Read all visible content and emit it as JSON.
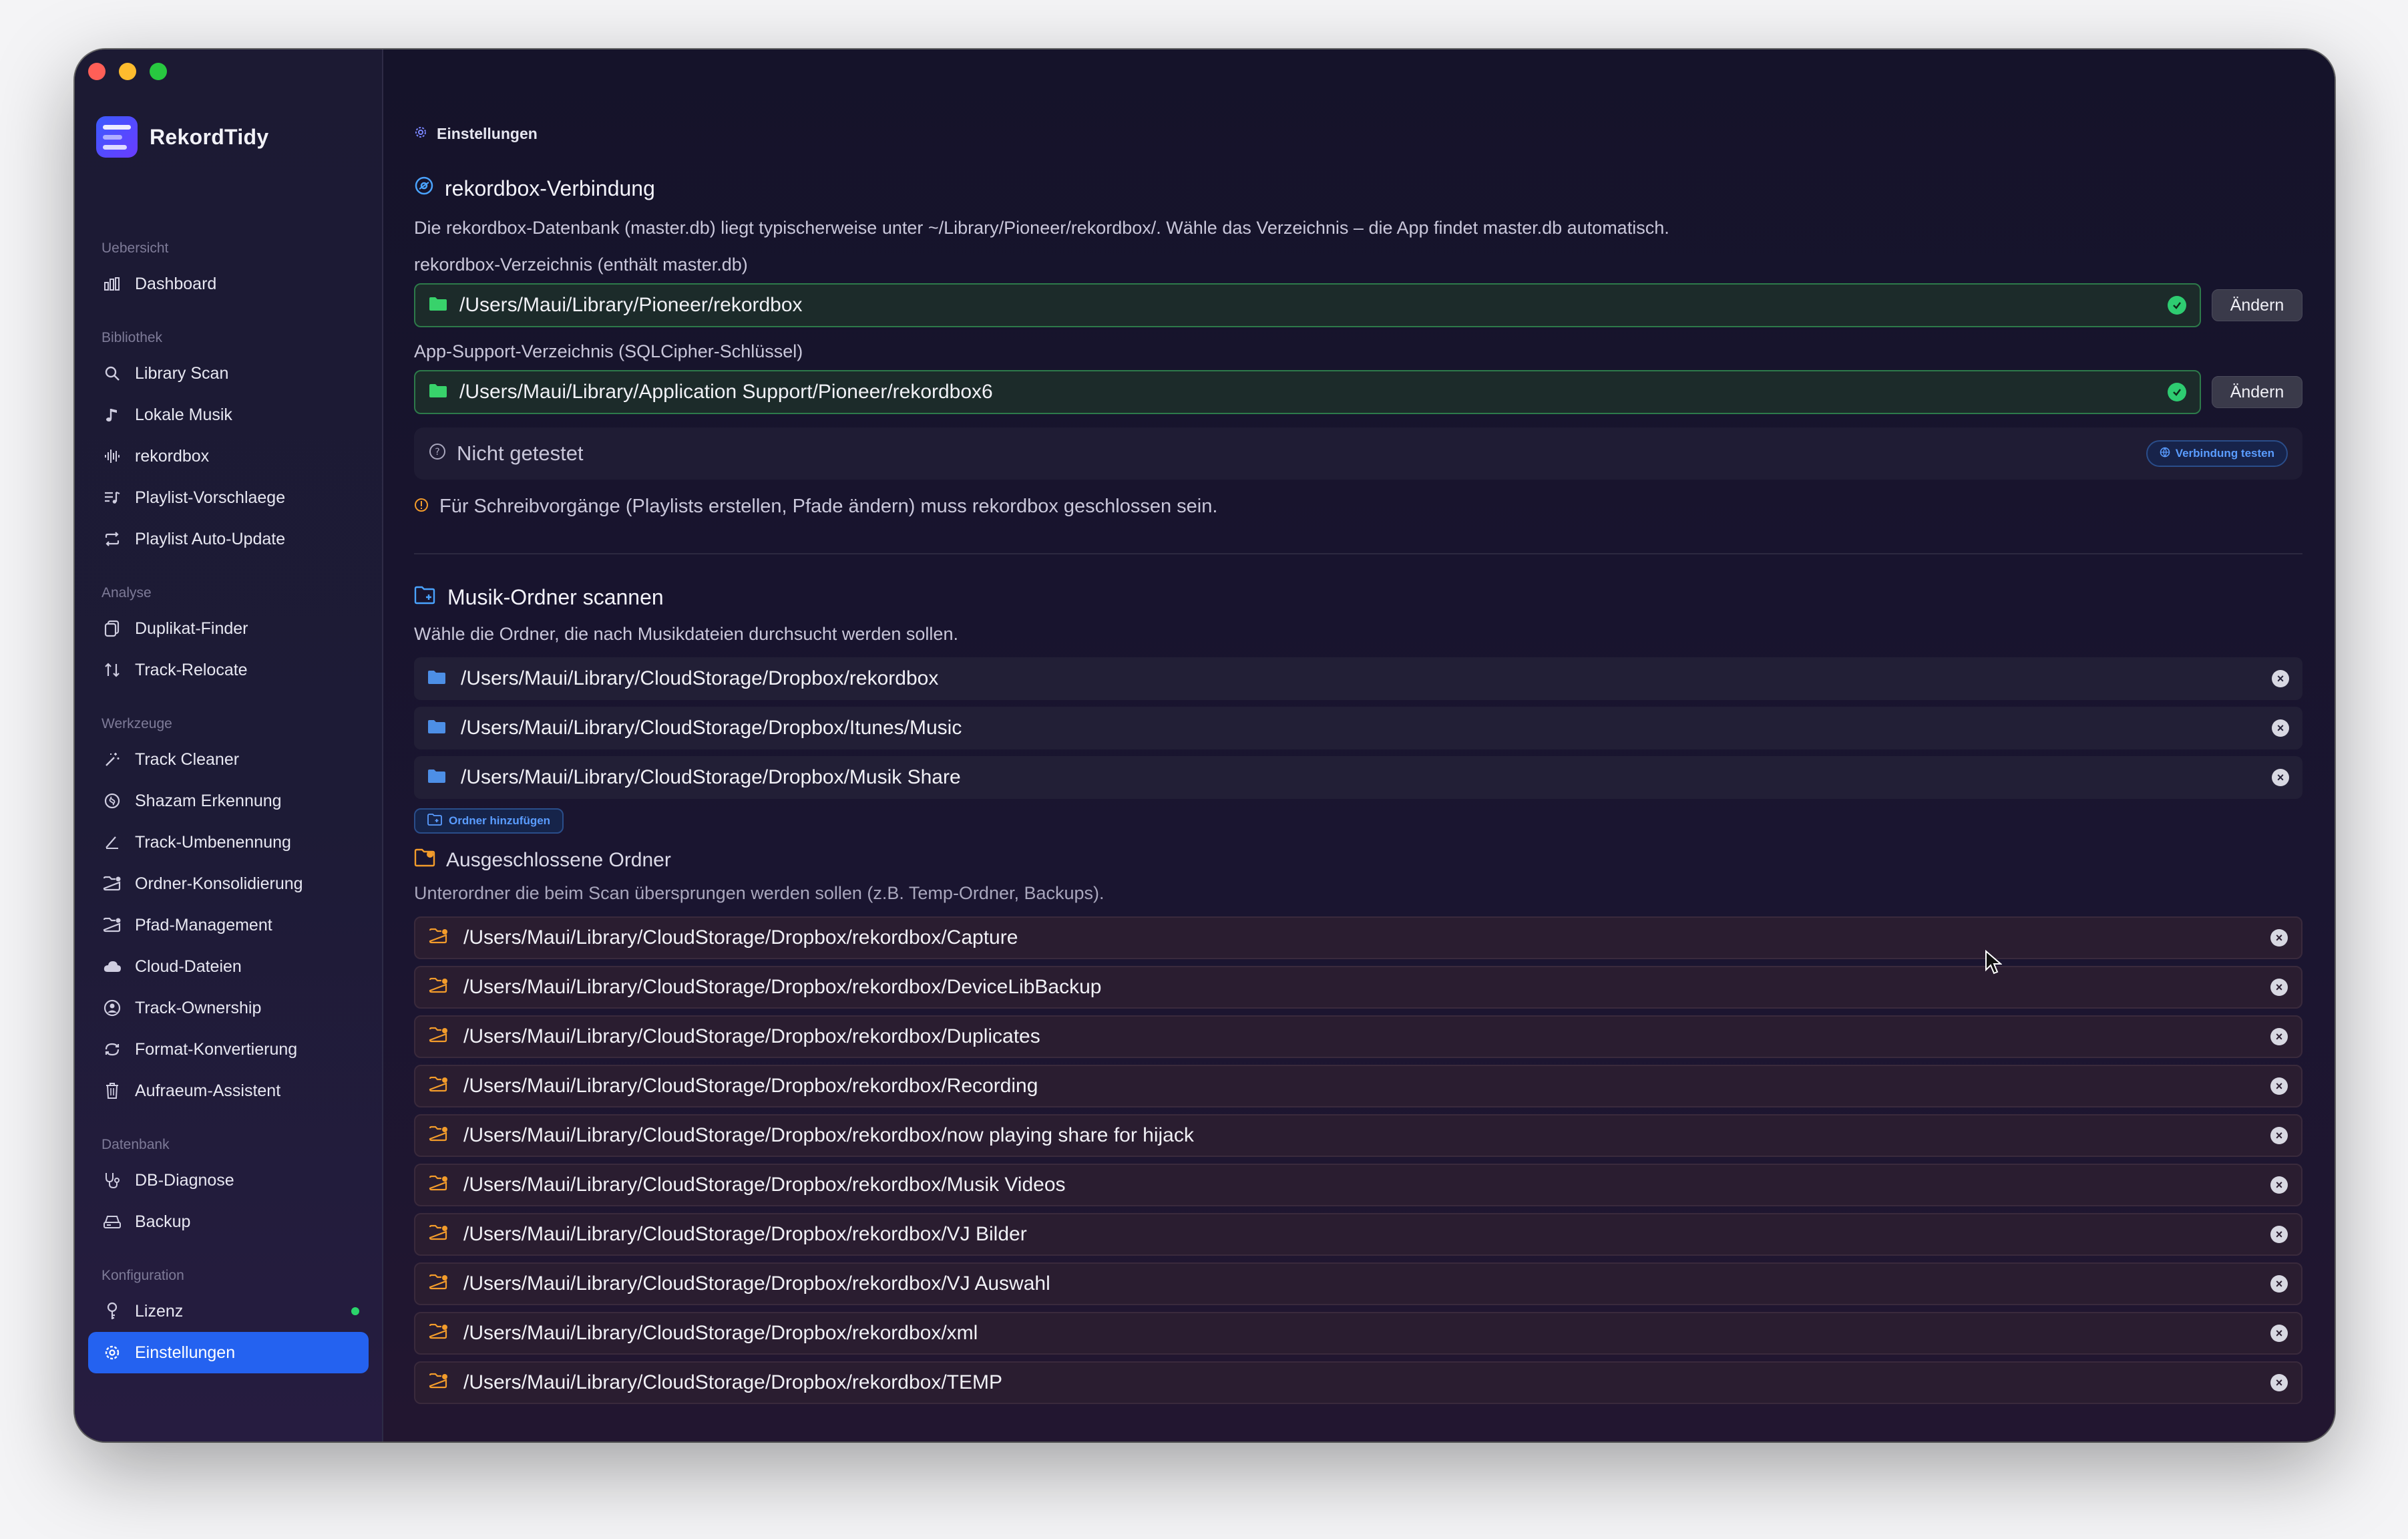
{
  "app": {
    "name": "RekordTidy"
  },
  "sidebar": {
    "sections": [
      {
        "label": "Uebersicht",
        "items": [
          {
            "label": "Dashboard",
            "icon": "bar-chart-icon"
          }
        ]
      },
      {
        "label": "Bibliothek",
        "items": [
          {
            "label": "Library Scan",
            "icon": "search-icon"
          },
          {
            "label": "Lokale Musik",
            "icon": "music-note-icon"
          },
          {
            "label": "rekordbox",
            "icon": "waveform-icon"
          },
          {
            "label": "Playlist-Vorschlaege",
            "icon": "playlist-icon"
          },
          {
            "label": "Playlist Auto-Update",
            "icon": "repeat-icon"
          }
        ]
      },
      {
        "label": "Analyse",
        "items": [
          {
            "label": "Duplikat-Finder",
            "icon": "duplicate-icon"
          },
          {
            "label": "Track-Relocate",
            "icon": "relocate-icon"
          }
        ]
      },
      {
        "label": "Werkzeuge",
        "items": [
          {
            "label": "Track Cleaner",
            "icon": "magic-wand-icon"
          },
          {
            "label": "Shazam Erkennung",
            "icon": "shazam-icon"
          },
          {
            "label": "Track-Umbenennung",
            "icon": "pencil-icon"
          },
          {
            "label": "Ordner-Konsolidierung",
            "icon": "folder-badge-icon"
          },
          {
            "label": "Pfad-Management",
            "icon": "folder-badge-icon"
          },
          {
            "label": "Cloud-Dateien",
            "icon": "cloud-icon"
          },
          {
            "label": "Track-Ownership",
            "icon": "ownership-icon"
          },
          {
            "label": "Format-Konvertierung",
            "icon": "convert-icon"
          },
          {
            "label": "Aufraeum-Assistent",
            "icon": "trash-icon"
          }
        ]
      },
      {
        "label": "Datenbank",
        "items": [
          {
            "label": "DB-Diagnose",
            "icon": "stethoscope-icon"
          },
          {
            "label": "Backup",
            "icon": "drive-icon"
          }
        ]
      },
      {
        "label": "Konfiguration",
        "items": [
          {
            "label": "Lizenz",
            "icon": "key-icon",
            "status_dot": true
          },
          {
            "label": "Einstellungen",
            "icon": "gear-icon",
            "active": true
          }
        ]
      }
    ]
  },
  "breadcrumb": {
    "label": "Einstellungen"
  },
  "connection": {
    "title": "rekordbox-Verbindung",
    "description": "Die rekordbox-Datenbank (master.db) liegt typischerweise unter ~/Library/Pioneer/rekordbox/. Wähle das Verzeichnis – die App findet master.db automatisch.",
    "dir_label": "rekordbox-Verzeichnis (enthält master.db)",
    "dir_value": "/Users/Maui/Library/Pioneer/rekordbox",
    "support_label": "App-Support-Verzeichnis (SQLCipher-Schlüssel)",
    "support_value": "/Users/Maui/Library/Application Support/Pioneer/rekordbox6",
    "change_label": "Ändern",
    "status_text": "Nicht getestet",
    "test_button": "Verbindung testen",
    "warning": "Für Schreibvorgänge (Playlists erstellen, Pfade ändern) muss rekordbox geschlossen sein."
  },
  "scan": {
    "title": "Musik-Ordner scannen",
    "description": "Wähle die Ordner, die nach Musikdateien durchsucht werden sollen.",
    "folders": [
      "/Users/Maui/Library/CloudStorage/Dropbox/rekordbox",
      "/Users/Maui/Library/CloudStorage/Dropbox/Itunes/Music",
      "/Users/Maui/Library/CloudStorage/Dropbox/Musik Share"
    ],
    "add_button": "Ordner hinzufügen",
    "excluded_title": "Ausgeschlossene Ordner",
    "excluded_description": "Unterordner die beim Scan übersprungen werden sollen (z.B. Temp-Ordner, Backups).",
    "excluded": [
      "/Users/Maui/Library/CloudStorage/Dropbox/rekordbox/Capture",
      "/Users/Maui/Library/CloudStorage/Dropbox/rekordbox/DeviceLibBackup",
      "/Users/Maui/Library/CloudStorage/Dropbox/rekordbox/Duplicates",
      "/Users/Maui/Library/CloudStorage/Dropbox/rekordbox/Recording",
      "/Users/Maui/Library/CloudStorage/Dropbox/rekordbox/now playing share for hijack",
      "/Users/Maui/Library/CloudStorage/Dropbox/rekordbox/Musik Videos",
      "/Users/Maui/Library/CloudStorage/Dropbox/rekordbox/VJ Bilder",
      "/Users/Maui/Library/CloudStorage/Dropbox/rekordbox/VJ Auswahl",
      "/Users/Maui/Library/CloudStorage/Dropbox/rekordbox/xml",
      "/Users/Maui/Library/CloudStorage/Dropbox/rekordbox/TEMP"
    ]
  },
  "colors": {
    "accent": "#2462f0",
    "success": "#2ecc71",
    "warning": "#f39c2b",
    "sidebar_bg": "#1c1a33",
    "main_bg": "#15132a"
  }
}
